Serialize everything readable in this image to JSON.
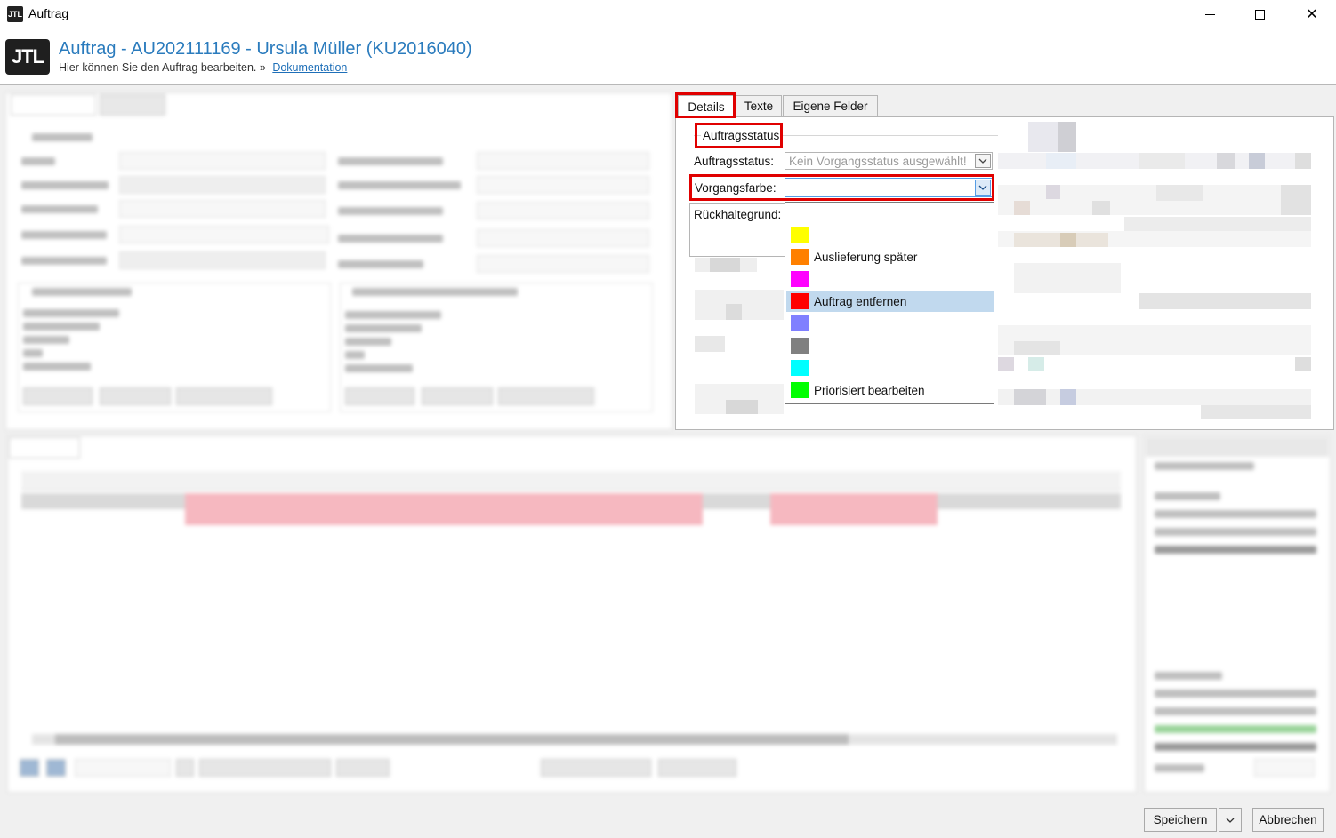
{
  "window": {
    "app_icon": "JTL",
    "title": "Auftrag",
    "controls": [
      "minimize-icon",
      "maximize-icon",
      "close-icon"
    ]
  },
  "header": {
    "logo": "JTL",
    "title": "Auftrag - AU202111169 - Ursula Müller (KU2016040)",
    "subtitle": "Hier können Sie den Auftrag bearbeiten.",
    "separator": "»",
    "link": "Dokumentation",
    "title_color": "#2a7bbd"
  },
  "right_panel": {
    "tabs": [
      {
        "label": "Details",
        "active": true
      },
      {
        "label": "Texte",
        "active": false
      },
      {
        "label": "Eigene Felder",
        "active": false
      }
    ],
    "group_title": "Auftragsstatus",
    "fields": {
      "auftragsstatus_label": "Auftragsstatus:",
      "auftragsstatus_value": "Kein Vorgangsstatus ausgewählt!",
      "vorgangsfarbe_label": "Vorgangsfarbe:",
      "vorgangsfarbe_value": "",
      "rueckhaltegrund_label": "Rückhaltegrund:"
    },
    "dropdown_options": [
      {
        "color": "",
        "label": ""
      },
      {
        "color": "#ffff00",
        "label": ""
      },
      {
        "color": "#ff8000",
        "label": "Auslieferung später"
      },
      {
        "color": "#ff00ff",
        "label": ""
      },
      {
        "color": "#ff0000",
        "label": "Auftrag entfernen",
        "selected": true
      },
      {
        "color": "#8080ff",
        "label": ""
      },
      {
        "color": "#808080",
        "label": ""
      },
      {
        "color": "#00ffff",
        "label": ""
      },
      {
        "color": "#00ff00",
        "label": "Priorisiert bearbeiten"
      }
    ],
    "highlight_color": "#e00000"
  },
  "footer": {
    "save_label": "Speichern",
    "cancel_label": "Abbrechen"
  }
}
